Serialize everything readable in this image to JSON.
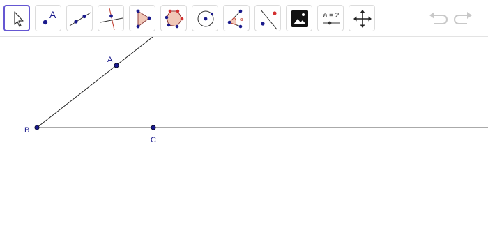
{
  "toolbar": {
    "tools": [
      {
        "name": "move",
        "icon": "arrow-cursor-icon",
        "active": true
      },
      {
        "name": "point",
        "icon": "point-icon",
        "label": "A"
      },
      {
        "name": "line",
        "icon": "line-through-two-points-icon"
      },
      {
        "name": "perpendicular-line",
        "icon": "perpendicular-line-icon"
      },
      {
        "name": "polygon",
        "icon": "triangle-polygon-icon"
      },
      {
        "name": "regular-polygon",
        "icon": "pentagon-icon"
      },
      {
        "name": "circle",
        "icon": "circle-with-center-icon"
      },
      {
        "name": "angle",
        "icon": "angle-icon",
        "label": "α"
      },
      {
        "name": "reflect",
        "icon": "reflect-about-line-icon"
      },
      {
        "name": "image",
        "icon": "image-icon"
      },
      {
        "name": "slider",
        "icon": "slider-icon",
        "label": "a = 2"
      },
      {
        "name": "move-graphics-view",
        "icon": "move-view-icon"
      }
    ],
    "undo_icon": "undo-icon",
    "redo_icon": "redo-icon"
  },
  "canvas": {
    "points": {
      "A": {
        "label": "A"
      },
      "B": {
        "label": "B"
      },
      "C": {
        "label": "C"
      }
    },
    "colors": {
      "point_fill": "#1a1a8c",
      "line": "#000000",
      "accent": "#6557d2",
      "polygon_fill": "#f0c8b8",
      "polygon_red_point": "#d32f2f"
    }
  }
}
